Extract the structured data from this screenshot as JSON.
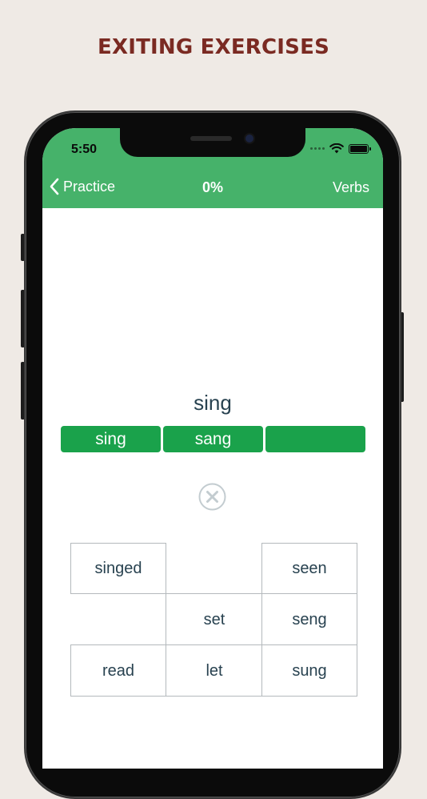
{
  "headline": "EXITING EXERCISES",
  "status_bar": {
    "time": "5:50"
  },
  "navbar": {
    "back_label": "Practice",
    "title": "0%",
    "right_label": "Verbs",
    "background": "#46b26a"
  },
  "exercise": {
    "prompt": "sing",
    "slots": [
      "sing",
      "sang",
      ""
    ],
    "slot_color": "#1aa24b",
    "clear_icon": "close-circle-icon",
    "choices": [
      "singed",
      "",
      "seen",
      "",
      "set",
      "seng",
      "read",
      "let",
      "sung"
    ]
  },
  "colors": {
    "page_background": "#efeae5",
    "headline": "#7a2a22",
    "text": "#284250"
  }
}
